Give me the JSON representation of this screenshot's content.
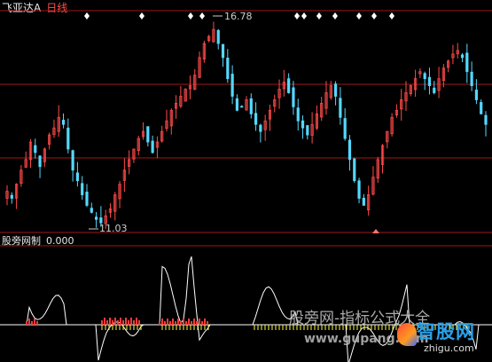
{
  "price_panel": {
    "stock_name": "飞亚达A",
    "period": "日线",
    "high_label": "16.78",
    "low_label": "11.03",
    "colors": {
      "up": "#ff4a4a",
      "down": "#54d8ff",
      "grid": "#a01818",
      "label": "#cccccc"
    }
  },
  "indicator_panel": {
    "name": "股旁网制",
    "value": "0.000",
    "colors": {
      "line": "#ffffff",
      "bars": "#ff3a3a",
      "ticks": "#ffff40"
    }
  },
  "watermarks": {
    "cn": "股旁网-指标公式大全",
    "url": "www.gupang.com",
    "brand": "智股网",
    "brand_url": "zhigu.com"
  },
  "chart_data": [
    {
      "type": "candlestick",
      "title": "飞亚达A 日线",
      "annotations": [
        {
          "text": "16.78",
          "meaning": "high"
        },
        {
          "text": "11.03",
          "meaning": "low"
        }
      ],
      "closes": [
        12.0,
        11.8,
        12.2,
        12.6,
        12.9,
        13.4,
        13.1,
        12.7,
        13.2,
        13.6,
        13.8,
        14.1,
        13.9,
        13.2,
        12.6,
        12.3,
        11.9,
        11.6,
        11.4,
        11.2,
        11.1,
        11.3,
        11.5,
        11.9,
        12.2,
        12.6,
        12.9,
        13.2,
        13.5,
        13.7,
        13.4,
        13.1,
        13.4,
        13.7,
        14.0,
        14.3,
        14.5,
        14.7,
        14.9,
        15.0,
        15.3,
        15.8,
        16.2,
        16.4,
        16.6,
        16.2,
        15.8,
        15.2,
        14.7,
        14.3,
        14.4,
        14.6,
        14.2,
        13.9,
        13.7,
        14.0,
        14.3,
        14.6,
        14.9,
        15.1,
        14.8,
        14.4,
        14.0,
        13.8,
        13.6,
        13.9,
        14.2,
        14.5,
        14.8,
        15.0,
        14.7,
        14.1,
        13.5,
        12.9,
        12.3,
        11.8,
        11.6,
        11.9,
        12.4,
        12.9,
        13.3,
        13.7,
        14.1,
        14.3,
        14.6,
        14.8,
        15.0,
        15.2,
        15.4,
        15.2,
        15.0,
        14.8,
        15.2,
        15.5,
        15.7,
        15.9,
        16.0,
        15.8,
        15.4,
        15.0,
        14.6,
        14.2,
        13.9
      ]
    },
    {
      "type": "line",
      "title": "股旁网制",
      "value": 0.0
    }
  ]
}
